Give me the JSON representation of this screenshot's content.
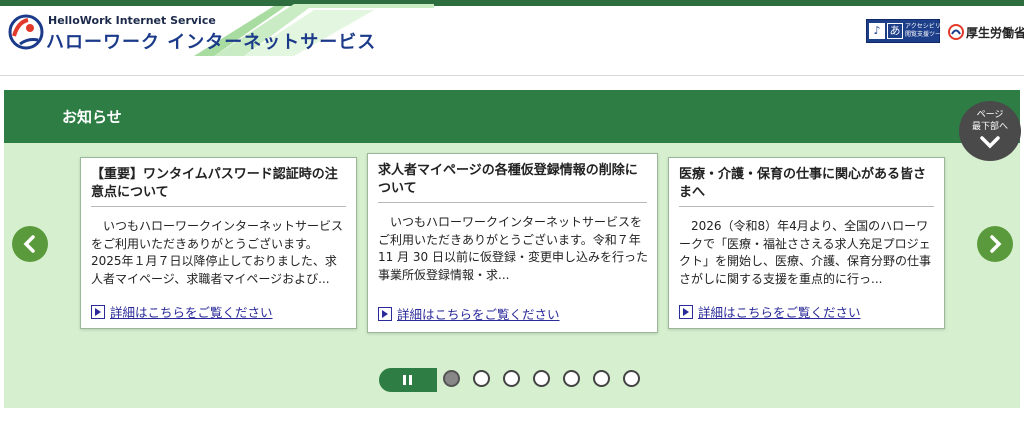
{
  "header": {
    "logo_en": "HelloWork Internet Service",
    "logo_jp": "ハローワーク インターネットサービス",
    "accessibility_tool": {
      "icon1": "あ",
      "line1": "アクセシビリティ",
      "line2": "閲覧支援ツール"
    },
    "ministry": {
      "name": "厚生労働省"
    }
  },
  "news": {
    "title": "お知らせ",
    "page_bottom_label_1": "ページ",
    "page_bottom_label_2": "最下部へ",
    "cards": [
      {
        "title": "【重要】ワンタイムパスワード認証時の注意点について",
        "body": "いつもハローワークインターネットサービスをご利用いただきありがとうございます。2025年１月７日以降停止しておりました、求人者マイページ、求職者マイページおよび...",
        "link": "詳細はこちらをご覧ください"
      },
      {
        "title": "求人者マイページの各種仮登録情報の削除について",
        "body": "いつもハローワークインターネットサービスをご利用いただきありがとうございます。令和７年 11 月 30 日以前に仮登録・変更申し込みを行った事業所仮登録情報・求...",
        "link": "詳細はこちらをご覧ください"
      },
      {
        "title": "医療・介護・保育の仕事に関心がある皆さまへ",
        "body": "2026（令和8）年4月より、全国のハローワークで「医療・福祉ささえる求人充足プロジェクト」を開始し、医療、介護、保育分野の仕事さがしに関する支援を重点的に行っ...",
        "link": "詳細はこちらをご覧ください"
      }
    ],
    "carousel": {
      "dot_count": 7,
      "active_index": 0
    }
  },
  "colors": {
    "brand_green": "#2e7d45",
    "body_green": "#d6f0cf",
    "arrow_green": "#5b9a3c",
    "link_blue": "#2a2a9a",
    "brand_blue": "#1b3a8a"
  }
}
